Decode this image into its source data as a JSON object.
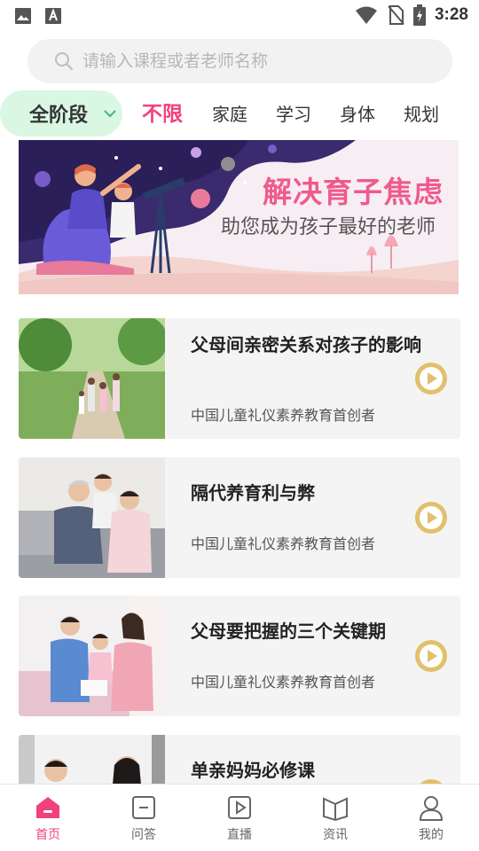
{
  "status_bar": {
    "time": "3:28",
    "left_icons": [
      "image-icon",
      "text-app-icon"
    ],
    "right_icons": [
      "wifi-icon",
      "no-sim-icon",
      "battery-charging-icon"
    ]
  },
  "search": {
    "placeholder": "请输入课程或者老师名称"
  },
  "filter": {
    "stage_label": "全阶段",
    "tabs": [
      {
        "label": "不限",
        "active": true
      },
      {
        "label": "家庭",
        "active": false
      },
      {
        "label": "学习",
        "active": false
      },
      {
        "label": "身体",
        "active": false
      },
      {
        "label": "规划",
        "active": false
      }
    ]
  },
  "banner": {
    "title": "解决育子焦虑",
    "subtitle": "助您成为孩子最好的老师"
  },
  "courses": [
    {
      "title": "父母间亲密关系对孩子的影响",
      "author": "中国儿童礼仪素养教育首创者"
    },
    {
      "title": "隔代养育利与弊",
      "author": "中国儿童礼仪素养教育首创者"
    },
    {
      "title": "父母要把握的三个关键期",
      "author": "中国儿童礼仪素养教育首创者"
    },
    {
      "title": "单亲妈妈必修课",
      "author": ""
    }
  ],
  "bottom_nav": [
    {
      "label": "首页",
      "icon": "home-icon",
      "active": true
    },
    {
      "label": "问答",
      "icon": "qa-icon",
      "active": false
    },
    {
      "label": "直播",
      "icon": "live-icon",
      "active": false
    },
    {
      "label": "资讯",
      "icon": "news-book-icon",
      "active": false
    },
    {
      "label": "我的",
      "icon": "profile-icon",
      "active": false
    }
  ],
  "colors": {
    "accent": "#f2417a",
    "stage_bg": "#d9f7e3",
    "play_button": "#e2bf6c",
    "card_bg": "#f4f4f4"
  }
}
